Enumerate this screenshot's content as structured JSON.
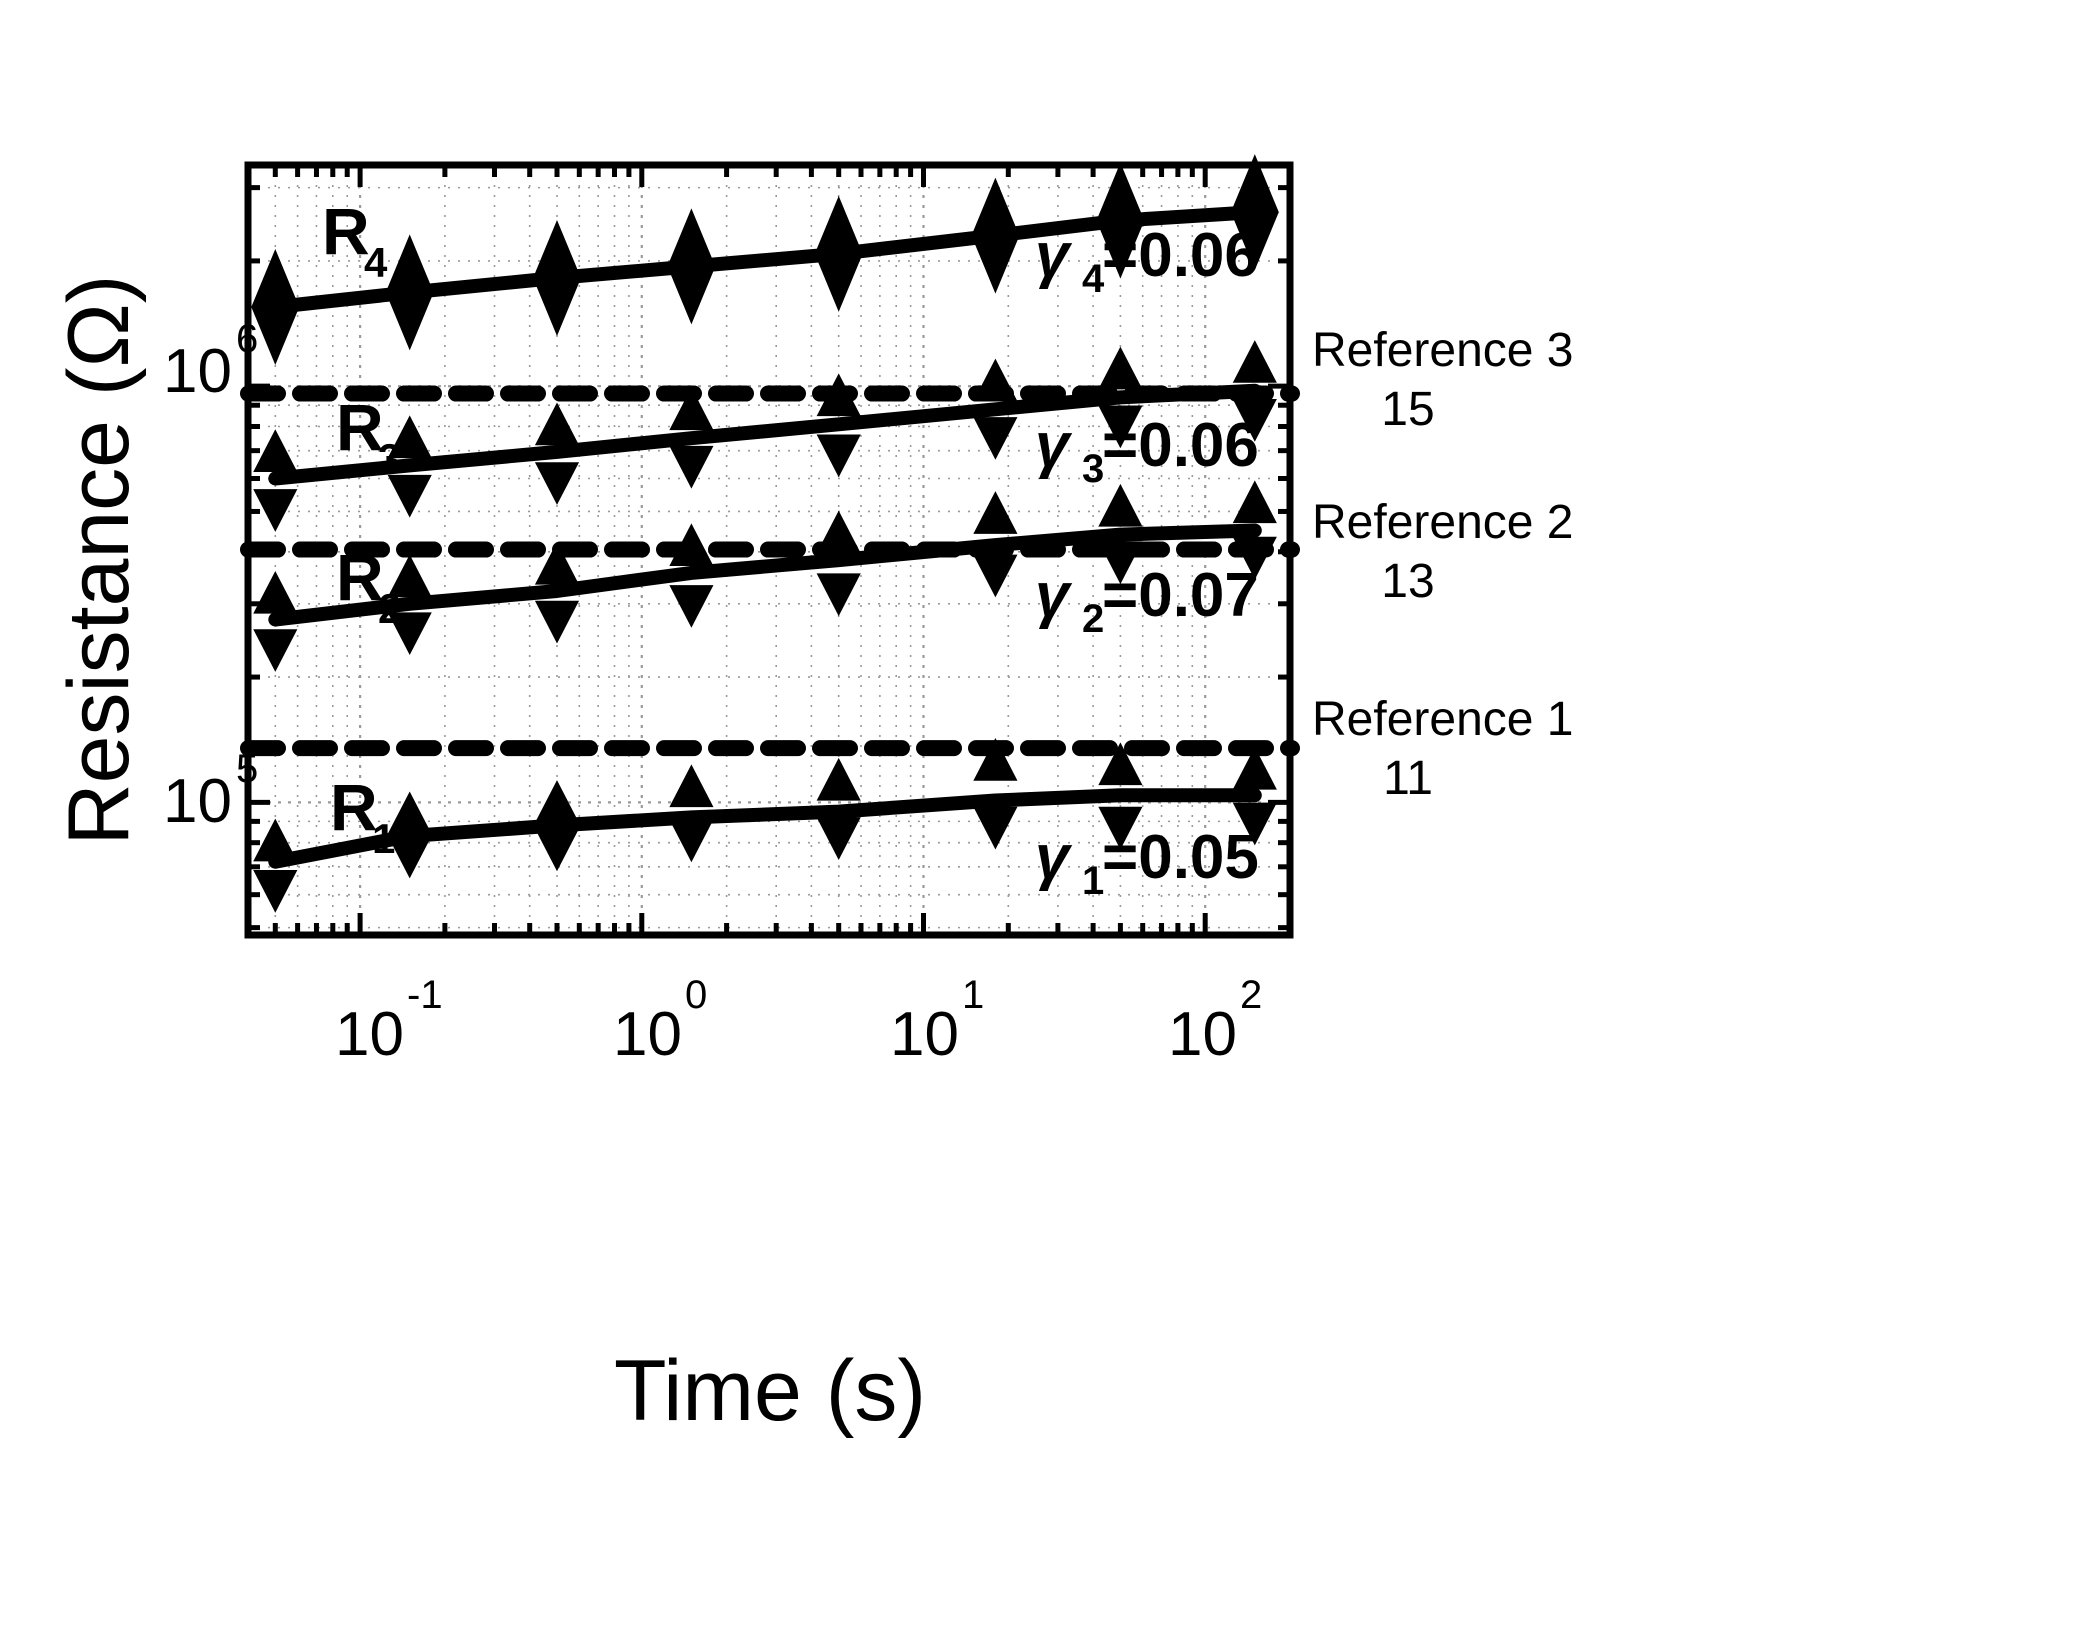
{
  "chart_data": {
    "type": "line",
    "title": "",
    "xlabel": "Time (s)",
    "ylabel": "Resistance (Ω)",
    "xscale": "log",
    "yscale": "log",
    "xlim": [
      0.04,
      200
    ],
    "ylim": [
      48000,
      3400000
    ],
    "grid": true,
    "legend_position": "inline-right",
    "xticks": [
      {
        "value": 0.1,
        "label": "10",
        "exp": "-1"
      },
      {
        "value": 1,
        "label": "10",
        "exp": "0"
      },
      {
        "value": 10,
        "label": "10",
        "exp": "1"
      },
      {
        "value": 100,
        "label": "10",
        "exp": "2"
      }
    ],
    "yticks": [
      {
        "value": 100000,
        "label": "10",
        "exp": "5"
      },
      {
        "value": 1000000,
        "label": "10",
        "exp": "6"
      }
    ],
    "x": [
      0.05,
      0.15,
      0.5,
      1.5,
      5,
      18,
      50,
      150
    ],
    "series": [
      {
        "name": "R_1",
        "label": "R",
        "sub": "1",
        "marker": "error-triangles",
        "style": "solid",
        "values": [
          72000,
          83000,
          88000,
          92000,
          95000,
          101000,
          104000,
          104000
        ],
        "upper": [
          80000,
          93000,
          99000,
          108000,
          112000,
          125000,
          122000,
          119000
        ],
        "lower": [
          62000,
          75000,
          78000,
          82000,
          83000,
          88000,
          88000,
          90000
        ],
        "has_dashed_overlay": true,
        "annotation": "γ",
        "annotation_sub": "1",
        "annotation_value": "=0.05"
      },
      {
        "name": "R_2",
        "label": "R",
        "sub": "2",
        "marker": "error-triangles",
        "style": "solid",
        "values": [
          275000,
          300000,
          322000,
          356000,
          382000,
          415000,
          440000,
          450000
        ],
        "upper": [
          315000,
          345000,
          370000,
          410000,
          440000,
          490000,
          510000,
          520000
        ],
        "lower": [
          235000,
          258000,
          275000,
          300000,
          320000,
          355000,
          382000,
          392000
        ],
        "annotation": "γ",
        "annotation_sub": "2",
        "annotation_value": "=0.07"
      },
      {
        "name": "R_3",
        "label": "R",
        "sub": "3",
        "marker": "error-triangles",
        "style": "solid",
        "values": [
          600000,
          645000,
          695000,
          750000,
          810000,
          880000,
          940000,
          975000
        ],
        "upper": [
          690000,
          745000,
          800000,
          870000,
          940000,
          1020000,
          1090000,
          1130000
        ],
        "lower": [
          510000,
          552000,
          592000,
          648000,
          690000,
          760000,
          810000,
          840000
        ],
        "annotation": "γ",
        "annotation_sub": "3",
        "annotation_value": "=0.06"
      },
      {
        "name": "R_4",
        "label": "R",
        "sub": "4",
        "marker": "diamond",
        "style": "solid",
        "values": [
          1550000,
          1680000,
          1820000,
          1940000,
          2080000,
          2300000,
          2500000,
          2620000
        ],
        "annotation": "γ",
        "annotation_sub": "4",
        "annotation_value": "=0.06"
      }
    ],
    "reference_lines": [
      {
        "name": "Reference 1",
        "sub_label": "11",
        "value": 135000,
        "style": "dashed"
      },
      {
        "name": "Reference 2",
        "sub_label": "13",
        "value": 405000,
        "style": "dashed"
      },
      {
        "name": "Reference 3",
        "sub_label": "15",
        "value": 960000,
        "style": "dashed"
      }
    ]
  },
  "colors": {
    "foreground": "#000000",
    "background": "#ffffff",
    "grid": "#a0a0a0"
  }
}
